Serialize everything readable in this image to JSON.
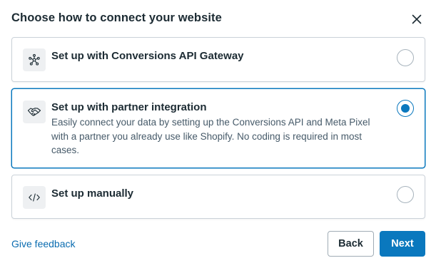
{
  "dialog": {
    "title": "Choose how to connect your website",
    "close_icon": "close-icon"
  },
  "options": [
    {
      "title": "Set up with Conversions API Gateway",
      "description": "",
      "icon": "network-nodes-icon",
      "selected": false
    },
    {
      "title": "Set up with partner integration",
      "description": "Easily connect your data by setting up the Conversions API and Meta Pixel with a partner you already use like Shopify. No coding is required in most cases.",
      "icon": "handshake-icon",
      "selected": true
    },
    {
      "title": "Set up manually",
      "description": "",
      "icon": "code-icon",
      "selected": false
    }
  ],
  "footer": {
    "feedback_label": "Give feedback",
    "back_label": "Back",
    "next_label": "Next"
  },
  "colors": {
    "accent": "#0a78be",
    "link": "#0a6cb0",
    "text": "#1c2b33",
    "border": "#cbd2d9"
  }
}
